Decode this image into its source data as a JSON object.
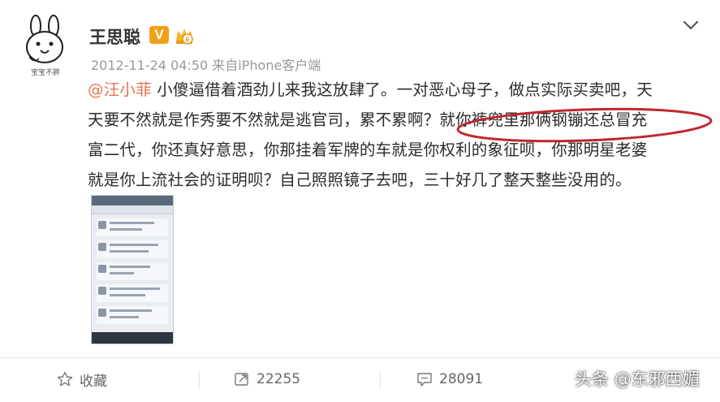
{
  "post": {
    "username": "王思聪",
    "badge_letter": "V",
    "timestamp": "2012-11-24 04:50",
    "source_prefix": "来自",
    "source": "iPhone客户端",
    "avatar_caption": "宝宝不胖",
    "mention": "@汪小菲",
    "text_lines": [
      " 小傻逼借着酒劲儿来我这放肆了。一对恶心母子，做点实际买卖吧，天",
      "天要不然就是作秀要不然就是逃官司，累不累啊？就你裤兜里那俩钢镚还总冒充",
      "富二代，你还真好意思，你那挂着军牌的车就是你权利的象征呗，你那明星老婆",
      "就是你上流社会的证明呗？自己照照镜子去吧，三十好几了整天整些没用的。"
    ]
  },
  "actions": {
    "favorite_label": "收藏",
    "repost_count": "22255",
    "comment_count": "28091"
  },
  "watermark": "头条 @东邪西媚",
  "colors": {
    "mention": "#eb7350",
    "highlight_oval": "#c0282d",
    "badge": "#f2a019"
  },
  "icons": [
    "rabbit-avatar-icon",
    "verified-v-icon",
    "member-icon",
    "chevron-down-icon",
    "star-icon",
    "repost-icon",
    "comment-icon"
  ]
}
